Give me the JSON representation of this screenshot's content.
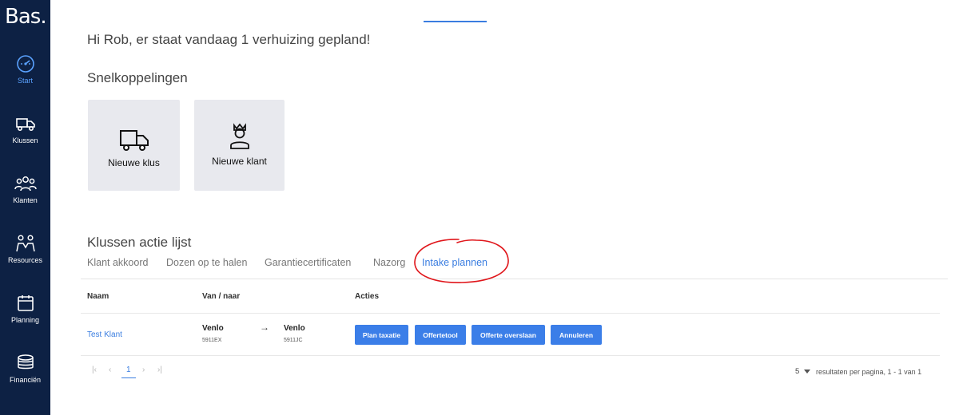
{
  "app": {
    "logo": "Bas."
  },
  "nav": {
    "items": [
      {
        "label": "Start",
        "icon": "dashboard-icon",
        "active": true
      },
      {
        "label": "Klussen",
        "icon": "truck-icon"
      },
      {
        "label": "Klanten",
        "icon": "users-icon"
      },
      {
        "label": "Resources",
        "icon": "people-icon"
      },
      {
        "label": "Planning",
        "icon": "calendar-icon"
      },
      {
        "label": "Financiën",
        "icon": "coins-icon"
      }
    ]
  },
  "greeting": "Hi Rob, er staat vandaag 1 verhuizing gepland!",
  "shortcuts": {
    "title": "Snelkoppelingen",
    "items": [
      {
        "label": "Nieuwe klus",
        "icon": "truck-icon"
      },
      {
        "label": "Nieuwe klant",
        "icon": "person-icon"
      }
    ]
  },
  "actions": {
    "title": "Klussen actie lijst",
    "tabs": [
      {
        "label": "Klant akkoord"
      },
      {
        "label": "Dozen op te halen"
      },
      {
        "label": "Garantiecertificaten"
      },
      {
        "label": "Nazorg"
      },
      {
        "label": "Intake plannen",
        "active": true
      }
    ],
    "columns": [
      "Naam",
      "Van / naar",
      "Acties"
    ],
    "rows": [
      {
        "name": "Test Klant",
        "from_city": "Venlo",
        "from_zip": "5911EX",
        "arrow": "→",
        "to_city": "Venlo",
        "to_zip": "5911JC",
        "buttons": [
          "Plan taxatie",
          "Offertetool",
          "Offerte overslaan",
          "Annuleren"
        ]
      }
    ]
  },
  "pagination": {
    "first": "|‹",
    "prev": "‹",
    "current": "1",
    "next": "›",
    "last": "›|",
    "per_page": "5",
    "results_text": "resultaten per pagina, 1 - 1 van 1"
  },
  "colors": {
    "sidebar": "#0d2144",
    "accent": "#3b7ee8",
    "annotation": "#e0161b"
  }
}
